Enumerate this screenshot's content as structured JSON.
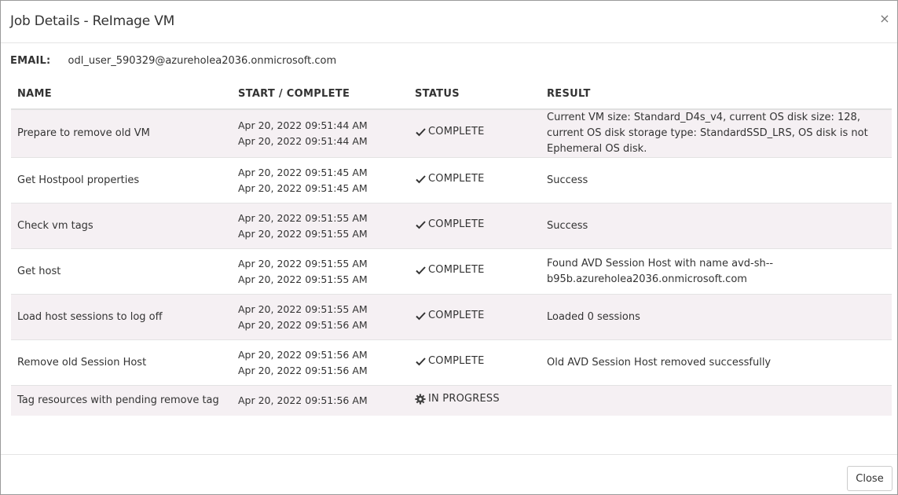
{
  "dialog": {
    "title": "Job Details - ReImage VM",
    "close_icon": "×",
    "email_label": "EMAIL:",
    "email_value": "odl_user_590329@azureholea2036.onmicrosoft.com",
    "close_button_label": "Close"
  },
  "table": {
    "headers": [
      "NAME",
      "START / COMPLETE",
      "STATUS",
      "RESULT"
    ],
    "rows": [
      {
        "name": "Prepare to remove old VM",
        "start": "Apr 20, 2022 09:51:44 AM",
        "complete": "Apr 20, 2022 09:51:44 AM",
        "status": "COMPLETE",
        "status_icon": "check-icon",
        "result": "Current VM size: Standard_D4s_v4, current OS disk size: 128, current OS disk storage type: StandardSSD_LRS, OS disk is not Ephemeral OS disk."
      },
      {
        "name": "Get Hostpool properties",
        "start": "Apr 20, 2022 09:51:45 AM",
        "complete": "Apr 20, 2022 09:51:45 AM",
        "status": "COMPLETE",
        "status_icon": "check-icon",
        "result": "Success"
      },
      {
        "name": "Check vm tags",
        "start": "Apr 20, 2022 09:51:55 AM",
        "complete": "Apr 20, 2022 09:51:55 AM",
        "status": "COMPLETE",
        "status_icon": "check-icon",
        "result": "Success"
      },
      {
        "name": "Get host",
        "start": "Apr 20, 2022 09:51:55 AM",
        "complete": "Apr 20, 2022 09:51:55 AM",
        "status": "COMPLETE",
        "status_icon": "check-icon",
        "result": "Found AVD Session Host with name avd-sh--b95b.azureholea2036.onmicrosoft.com"
      },
      {
        "name": "Load host sessions to log off",
        "start": "Apr 20, 2022 09:51:55 AM",
        "complete": "Apr 20, 2022 09:51:56 AM",
        "status": "COMPLETE",
        "status_icon": "check-icon",
        "result": "Loaded 0 sessions"
      },
      {
        "name": "Remove old Session Host",
        "start": "Apr 20, 2022 09:51:56 AM",
        "complete": "Apr 20, 2022 09:51:56 AM",
        "status": "COMPLETE",
        "status_icon": "check-icon",
        "result": "Old AVD Session Host removed successfully"
      },
      {
        "name": "Tag resources with pending remove tag",
        "start": "Apr 20, 2022 09:51:56 AM",
        "complete": "",
        "status": "IN PROGRESS",
        "status_icon": "gear-icon",
        "result": ""
      }
    ]
  }
}
